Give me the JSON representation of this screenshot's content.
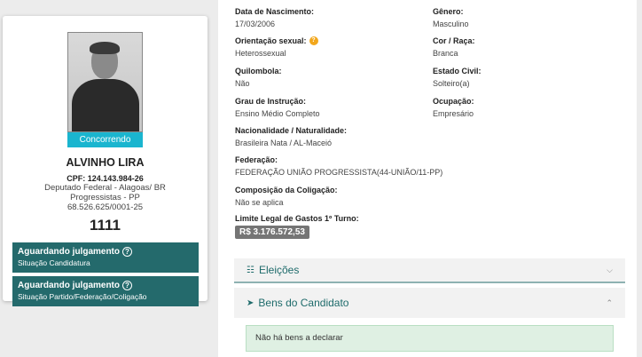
{
  "candidate": {
    "status_photo": "Concorrendo",
    "name": "ALVINHO LIRA",
    "cpf": "CPF: 124.143.984-26",
    "cargo": "Deputado Federal - Alagoas/ BR",
    "partido": "Progressistas - PP",
    "cnpj": "68.526.625/0001-25",
    "numero": "1111"
  },
  "status_boxes": [
    {
      "title": "Aguardando julgamento",
      "subtitle": "Situação Candidatura"
    },
    {
      "title": "Aguardando julgamento",
      "subtitle": "Situação Partido/Federação/Coligação"
    }
  ],
  "fields": {
    "nascimento": {
      "label": "Data de Nascimento:",
      "value": "17/03/2006"
    },
    "genero": {
      "label": "Gênero:",
      "value": "Masculino"
    },
    "orientacao": {
      "label": "Orientação sexual:",
      "value": "Heterossexual"
    },
    "cor": {
      "label": "Cor / Raça:",
      "value": "Branca"
    },
    "quilombola": {
      "label": "Quilombola:",
      "value": "Não"
    },
    "estado_civil": {
      "label": "Estado Civil:",
      "value": "Solteiro(a)"
    },
    "instrucao": {
      "label": "Grau de Instrução:",
      "value": "Ensino Médio Completo"
    },
    "ocupacao": {
      "label": "Ocupação:",
      "value": "Empresário"
    },
    "nacionalidade": {
      "label": "Nacionalidade / Naturalidade:",
      "value": "Brasileira Nata / AL-Maceió"
    },
    "federacao": {
      "label": "Federação:",
      "value": "FEDERAÇÃO UNIÃO PROGRESSISTA(44-UNIÃO/11-PP)"
    },
    "coligacao": {
      "label": "Composição da Coligação:",
      "value": "Não se aplica"
    },
    "limite": {
      "label": "Limite Legal de Gastos 1º Turno:",
      "value": "R$ 3.176.572,53"
    }
  },
  "accordions": {
    "eleicoes": "Eleições",
    "bens": "Bens do Candidato",
    "bens_alert": "Não há bens a declarar"
  },
  "colors": {
    "accent": "#246a6c",
    "status_photo": "#1ab5cf",
    "info": "#f2a71c"
  }
}
